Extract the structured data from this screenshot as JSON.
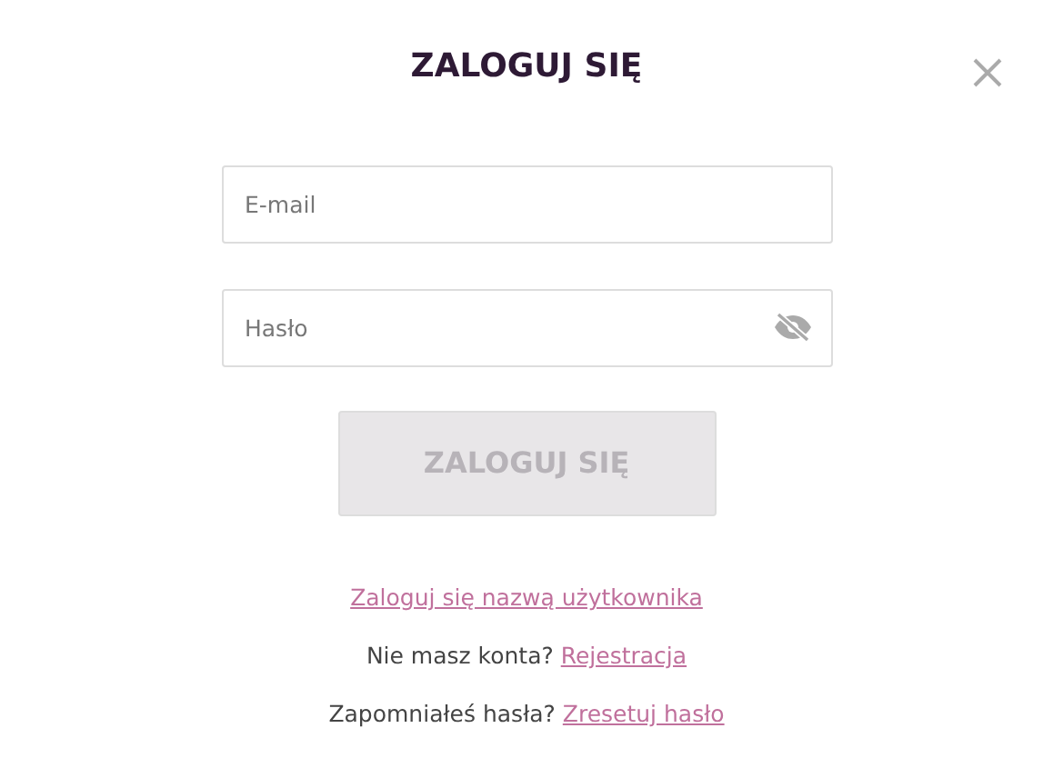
{
  "dialog": {
    "title": "ZALOGUJ SIĘ"
  },
  "fields": [
    {
      "kind": "text",
      "placeholder": "E-mail"
    },
    {
      "kind": "password",
      "placeholder": "Hasło",
      "revealed": false
    }
  ],
  "submit": {
    "label": "ZALOGUJ SIĘ",
    "disabled": true
  },
  "links": [
    {
      "link": "Zaloguj się nazwą użytkownika"
    },
    {
      "prompt": "Nie masz konta?",
      "link": "Rejestracja"
    },
    {
      "prompt": "Zapomniałeś hasła?",
      "link": "Zresetuj hasło"
    }
  ]
}
